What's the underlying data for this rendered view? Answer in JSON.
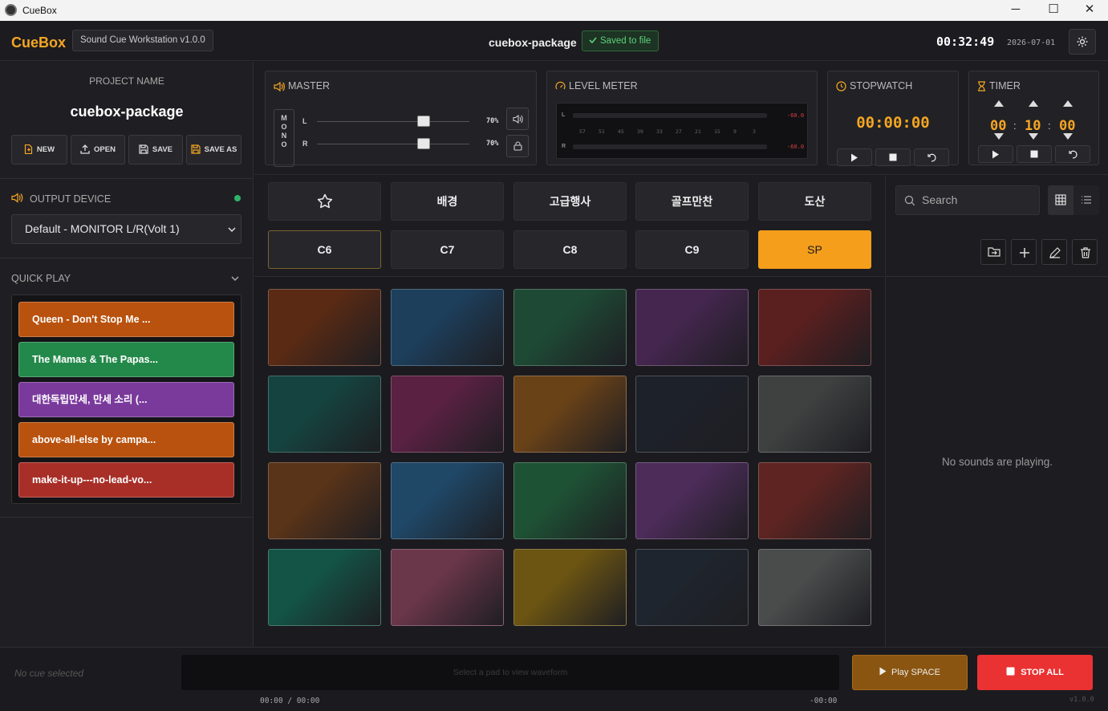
{
  "window": {
    "title": "CueBox",
    "minimize": "─",
    "maximize": "☐",
    "close": "✕"
  },
  "header": {
    "logo": "CueBox",
    "version": "Sound Cue Workstation v1.0.0",
    "project_name": "cuebox-package",
    "saved": "Saved to file",
    "clock": "00:32:49",
    "date": "2026-07-01"
  },
  "project": {
    "label": "PROJECT NAME",
    "name": "cuebox-package",
    "buttons": [
      "NEW",
      "OPEN",
      "SAVE",
      "SAVE AS"
    ]
  },
  "output": {
    "label": "OUTPUT DEVICE",
    "device": "Default - MONITOR L/R(Volt 1)"
  },
  "quick_play": {
    "label": "QUICK PLAY",
    "items": [
      {
        "label": "Queen - Don't Stop Me ...",
        "color": "#b9520e"
      },
      {
        "label": "The Mamas & The Papas...",
        "color": "#23894a"
      },
      {
        "label": "대한독립만세, 만세 소리 (...",
        "color": "#7a3a9c"
      },
      {
        "label": "above-all-else by campa...",
        "color": "#b9520e"
      },
      {
        "label": "make-it-up---no-lead-vo...",
        "color": "#a82f28"
      }
    ]
  },
  "master": {
    "title": "MASTER",
    "mono": "MONO",
    "left_label": "L",
    "right_label": "R",
    "left_volume": "70%",
    "right_volume": "70%",
    "left_level": 0.7,
    "right_level": 0.7
  },
  "level_meter": {
    "title": "LEVEL METER",
    "left_label": "L",
    "right_label": "R",
    "left_db": "-60.0",
    "right_db": "-60.0",
    "scale": [
      "57",
      "51",
      "45",
      "39",
      "33",
      "27",
      "21",
      "15",
      "9",
      "3"
    ]
  },
  "stopwatch": {
    "title": "STOPWATCH",
    "time": "00:00:00"
  },
  "timer": {
    "title": "TIMER",
    "hours": "00",
    "minutes": "10",
    "seconds": "00",
    "sep": ":"
  },
  "categories": {
    "row1": [
      "",
      "배경",
      "고급행사",
      "골프만찬",
      "도산"
    ],
    "row2": [
      "C6",
      "C7",
      "C8",
      "C9",
      "SP"
    ],
    "selected": "C6",
    "active": "SP"
  },
  "pads": [
    [
      "#5a2a14",
      "#1d3f5c",
      "#1e4a35",
      "#45264f",
      "#5a1f1f"
    ],
    [
      "#154440",
      "#5a2143",
      "#6a4218",
      "#1d2129",
      "#3f4141"
    ],
    [
      "#5a3418",
      "#1f4766",
      "#1e5235",
      "#4d2c5a",
      "#5e2421"
    ],
    [
      "#135447",
      "#6a3649",
      "#6c5512",
      "#1f252e",
      "#4a4c4c"
    ]
  ],
  "right_panel": {
    "search_placeholder": "Search",
    "empty": "No sounds are playing."
  },
  "footer": {
    "no_cue": "No cue selected",
    "waveform_hint": "Select a pad to view waveform",
    "time_current": "00:00 / 00:00",
    "time_remaining": "-00:00",
    "play_label": "Play",
    "play_key": "SPACE",
    "stop_all": "STOP ALL",
    "version": "v1.0.0"
  },
  "colors": {
    "accent": "#f5a623",
    "active_category": "#f59e1b",
    "stop": "#ea3232",
    "saved": "#5ed27a"
  }
}
